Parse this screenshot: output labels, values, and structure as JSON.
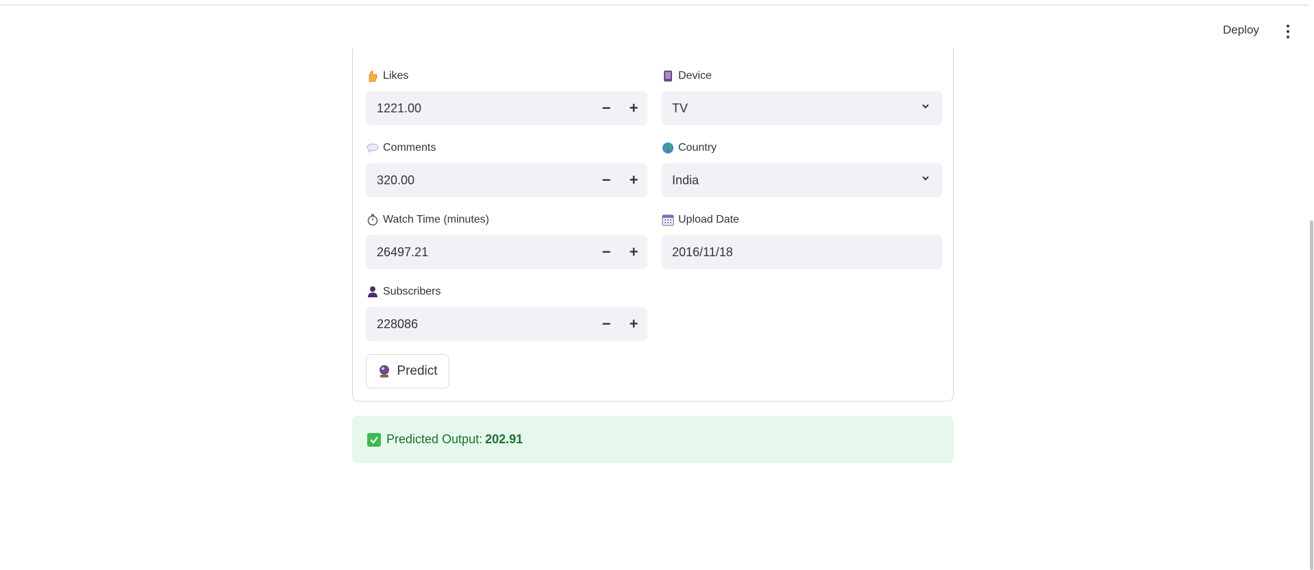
{
  "header": {
    "deploy_label": "Deploy"
  },
  "fields": {
    "likes": {
      "label": "Likes",
      "icon": "thumbs-up-icon",
      "value": "1221.00"
    },
    "comments": {
      "label": "Comments",
      "icon": "speech-bubble-icon",
      "value": "320.00"
    },
    "watch_time": {
      "label": "Watch Time (minutes)",
      "icon": "stopwatch-icon",
      "value": "26497.21"
    },
    "subscribers": {
      "label": "Subscribers",
      "icon": "person-icon",
      "value": "228086"
    },
    "device": {
      "label": "Device",
      "icon": "phone-icon",
      "value": "TV"
    },
    "country": {
      "label": "Country",
      "icon": "globe-icon",
      "value": "India"
    },
    "upload_date": {
      "label": "Upload Date",
      "icon": "calendar-icon",
      "value": "2016/11/18"
    }
  },
  "stepper": {
    "minus": "−",
    "plus": "+"
  },
  "predict_button": {
    "label": "Predict",
    "icon": "crystal-ball-icon"
  },
  "result": {
    "label": "Predicted Output:",
    "value": "202.91",
    "icon": "check-icon"
  },
  "colors": {
    "input_bg": "#f0f2f6",
    "success_bg": "#e6f7ec",
    "success_text": "#177233",
    "text": "#31333f"
  }
}
